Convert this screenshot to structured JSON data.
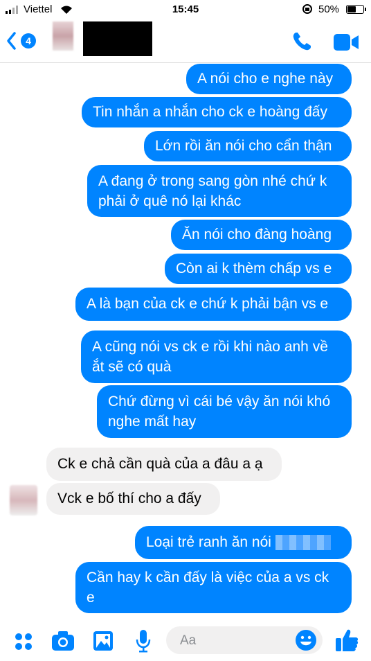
{
  "status_bar": {
    "carrier": "Viettel",
    "time": "15:45",
    "battery": "50%",
    "battery_level": 0.5
  },
  "header": {
    "unread_count": "4"
  },
  "messages": [
    {
      "dir": "out",
      "lines": [
        "A nói cho e nghe này"
      ]
    },
    {
      "dir": "out",
      "lines": [
        "Tin nhắn a nhắn cho ck e hoàng đấy"
      ]
    },
    {
      "dir": "out",
      "lines": [
        "Lớn rồi ăn nói cho cẩn thận"
      ]
    },
    {
      "dir": "out",
      "lines": [
        "A đang ở trong sang gòn nhé chứ k",
        "phải ở quê nó lại khác"
      ]
    },
    {
      "dir": "out",
      "lines": [
        "Ăn nói cho đàng hoàng"
      ]
    },
    {
      "dir": "out",
      "lines": [
        "Còn ai k thèm chấp vs e"
      ]
    },
    {
      "dir": "out",
      "lines": [
        "A là bạn của ck e chứ k phải bận vs e"
      ]
    },
    {
      "dir": "out",
      "lines": [
        "A cũng nói vs ck e rồi khi nào anh về",
        "ắt sẽ có quà"
      ]
    },
    {
      "dir": "out",
      "lines": [
        "Chứ đừng vì cái bé vậy ăn nói khó",
        "nghe mất hay"
      ]
    },
    {
      "dir": "in",
      "lines": [
        "Ck e chả cần quà của a đâu a ạ"
      ]
    },
    {
      "dir": "in",
      "lines": [
        "Vck e bố thí cho a đấy"
      ]
    },
    {
      "dir": "out",
      "lines": [
        "Loại trẻ ranh ăn nói"
      ]
    },
    {
      "dir": "out",
      "lines": [
        "Cần hay k cần đấy là việc của a vs ck",
        "e"
      ]
    }
  ],
  "composer": {
    "placeholder": "Aa"
  },
  "colors": {
    "accent": "#0084ff",
    "incoming_bg": "#f1f0f0"
  }
}
